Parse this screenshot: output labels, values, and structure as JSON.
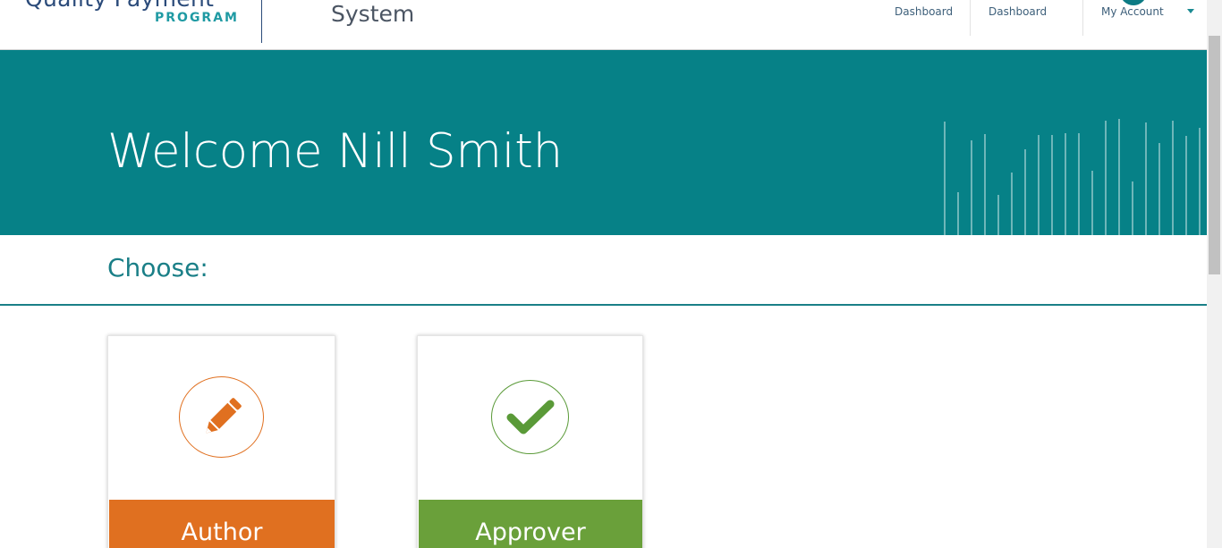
{
  "header": {
    "logo_top_text": "Quality Payment",
    "logo_program_text": "PROGRAM",
    "system_title": "System",
    "nav": [
      {
        "label": "Dashboard"
      },
      {
        "label": "Dashboard"
      },
      {
        "label": "My Account"
      }
    ]
  },
  "banner": {
    "welcome_text": "Welcome Nill Smith"
  },
  "choose": {
    "label": "Choose:"
  },
  "cards": [
    {
      "label": "Author",
      "icon": "pencil-icon",
      "color": "#e07020"
    },
    {
      "label": "Approver",
      "icon": "checkmark-icon",
      "color": "#6aa03a"
    }
  ],
  "colors": {
    "banner_teal": "#068187",
    "accent_teal": "#1a7f87",
    "author_orange": "#e07020",
    "approver_green": "#6aa03a"
  }
}
